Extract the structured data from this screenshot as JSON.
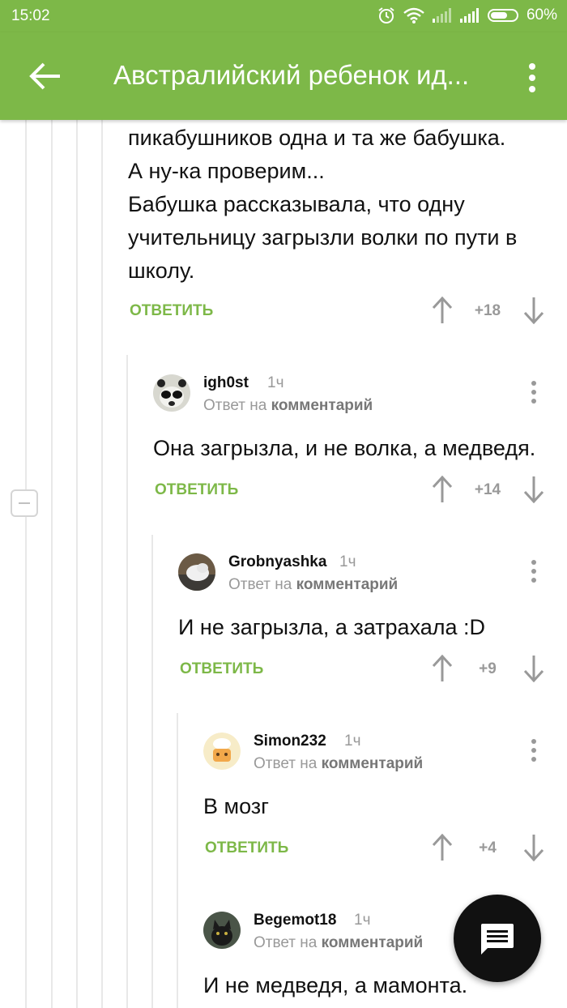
{
  "status": {
    "time": "15:02",
    "battery": "60%"
  },
  "appbar": {
    "title": "Австралийский ребенок ид..."
  },
  "comment0": {
    "lines": [
      "пикабушников одна и та же бабушка.",
      "А ну-ка проверим...",
      "Бабушка рассказывала, что одну",
      "учительницу загрызли волки по пути в",
      "школу."
    ],
    "reply_label": "ОТВЕТИТЬ",
    "score": "+18"
  },
  "comments": [
    {
      "username": "igh0st",
      "time": "1ч",
      "reply_to_prefix": "Ответ на",
      "reply_to_link": "комментарий",
      "text": "Она загрызла, и не волка, а медведя.",
      "reply_label": "ОТВЕТИТЬ",
      "score": "+14"
    },
    {
      "username": "Grobnyashka",
      "time": "1ч",
      "reply_to_prefix": "Ответ на",
      "reply_to_link": "комментарий",
      "text": "И не загрызла, а затрахала :D",
      "reply_label": "ОТВЕТИТЬ",
      "score": "+9"
    },
    {
      "username": "Simon232",
      "time": "1ч",
      "reply_to_prefix": "Ответ на",
      "reply_to_link": "комментарий",
      "text": "В мозг",
      "reply_label": "ОТВЕТИТЬ",
      "score": "+4"
    },
    {
      "username": "Begemot18",
      "time": "1ч",
      "reply_to_prefix": "Ответ на",
      "reply_to_link": "комментарий",
      "text": "И не медведя, а мамонта."
    }
  ],
  "colors": {
    "accent": "#7db848",
    "fab": "#111111"
  }
}
